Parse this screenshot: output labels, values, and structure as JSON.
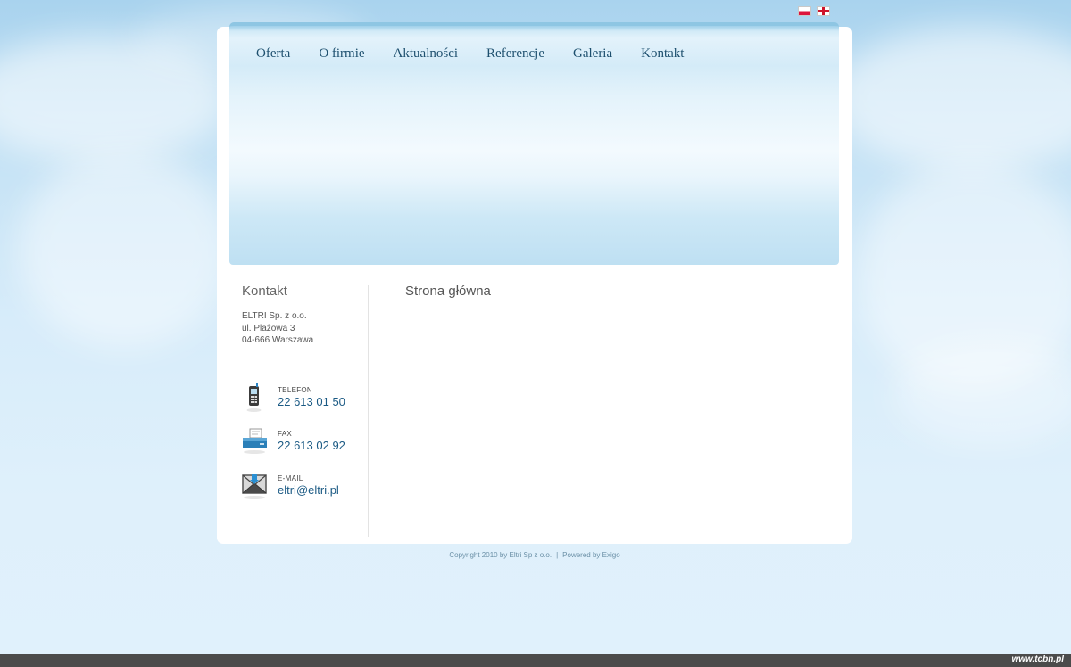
{
  "languages": [
    {
      "code": "pl",
      "icon": "flag-pl-icon"
    },
    {
      "code": "en",
      "icon": "flag-en-icon"
    }
  ],
  "nav": {
    "items": [
      {
        "label": "Oferta"
      },
      {
        "label": "O firmie"
      },
      {
        "label": "Aktualności"
      },
      {
        "label": "Referencje"
      },
      {
        "label": "Galeria"
      },
      {
        "label": "Kontakt"
      }
    ]
  },
  "sidebar": {
    "title": "Kontakt",
    "address": {
      "company": "ELTRI Sp. z o.o.",
      "street": "ul. Plażowa 3",
      "city": "04-666 Warszawa"
    },
    "phone": {
      "label": "TELEFON",
      "value": "22 613 01 50",
      "icon": "mobile-phone-icon"
    },
    "fax": {
      "label": "FAX",
      "value": "22 613 02 92",
      "icon": "fax-icon"
    },
    "email": {
      "label": "E-MAIL",
      "value": "eltri@eltri.pl",
      "icon": "envelope-icon"
    }
  },
  "main": {
    "title": "Strona główna"
  },
  "footer": {
    "copyright": "Copyright 2010 by Eltri Sp z o.o.",
    "separator": "|",
    "powered": "Powered by Exigo"
  },
  "watermark": "www.tcbn.pl",
  "colors": {
    "nav_text": "#1d4f6e",
    "accent_blue": "#1b5a84",
    "header_border": "#8ec6e3"
  }
}
